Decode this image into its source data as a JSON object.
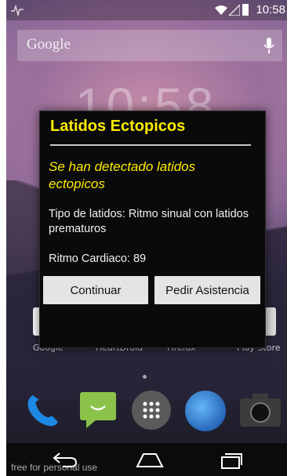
{
  "status_bar": {
    "time": "10:58",
    "icons": [
      "pulse-icon",
      "wifi-icon",
      "signal-icon",
      "battery-icon"
    ]
  },
  "home": {
    "search_label": "Google",
    "clock": "10:58",
    "apps": [
      {
        "label": "Google",
        "icon": "google-app-icon",
        "color": "#ffffff"
      },
      {
        "label": "HeartDroid",
        "icon": "heartdroid-icon",
        "color": "#3a3a3a"
      },
      {
        "label": "Firefox",
        "icon": "firefox-icon",
        "color": "#e66000"
      },
      {
        "label": "Play Store",
        "icon": "play-store-icon",
        "color": "#ffffff"
      }
    ],
    "dock": [
      {
        "icon": "phone-icon",
        "color": "#1e88e5"
      },
      {
        "icon": "messaging-icon",
        "color": "#8bc34a"
      },
      {
        "icon": "app-drawer-icon",
        "color": "#555555"
      },
      {
        "icon": "browser-icon",
        "color": "#1565c0"
      },
      {
        "icon": "camera-icon",
        "color": "#333333"
      }
    ],
    "watermark": "free for personal use"
  },
  "dialog": {
    "title": "Latidos Ectopicos",
    "subtitle": "Se han detectado latidos ectopicos",
    "type_text": "Tipo de latidos: Ritmo sinual con latidos prematuros",
    "heart_rate": "Ritmo Cardiaco: 89",
    "buttons": {
      "continue": "Continuar",
      "assist": "Pedir Asistencia"
    },
    "accent_color": "#ffeb00"
  },
  "nav": {
    "icons": [
      "back-icon",
      "home-icon",
      "recent-apps-icon"
    ]
  }
}
